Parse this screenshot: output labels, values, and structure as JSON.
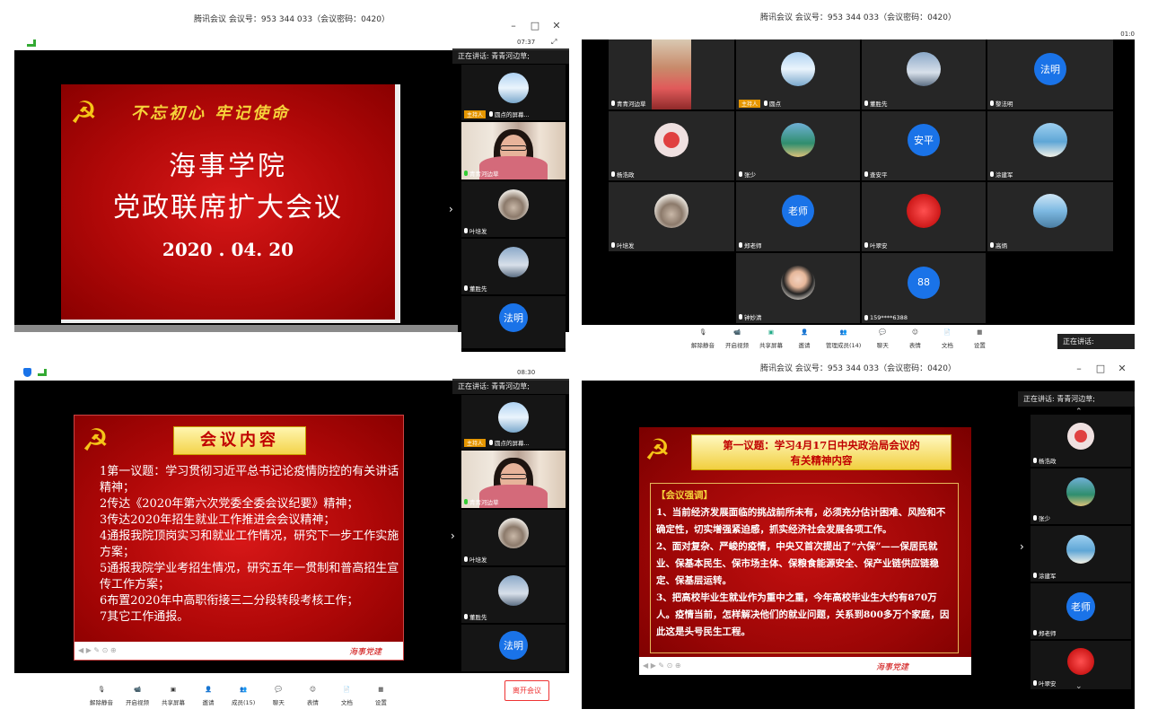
{
  "app_title": "腾讯会议 会议号：953 344 033（会议密码：0420）",
  "speaker_label": "正在讲话: 青青河边草;",
  "speaker_label_short": "正在讲话:",
  "timer_tl": "07:37",
  "timer_bl": "08:30",
  "timer_tr": "01:0",
  "host_badge": "主持人",
  "toolbar": {
    "mute": "解除静音",
    "video": "开启视频",
    "share": "共享屏幕",
    "invite": "邀请",
    "members15": "成员(15)",
    "members14": "管理成员(14)",
    "chat": "聊天",
    "emoji": "表情",
    "docs": "文档",
    "settings": "设置",
    "leave": "离开会议"
  },
  "slide1": {
    "motto": "不忘初心 牢记使命",
    "title1": "海事学院",
    "title2": "党政联席扩大会议",
    "date": "2020 . 04. 20"
  },
  "slide2": {
    "title": "会议内容",
    "items": [
      "1第一议题：学习贯彻习近平总书记论疫情防控的有关讲话精神；",
      "2传达《2020年第六次党委全委会议纪要》精神；",
      "3传达2020年招生就业工作推进会会议精神；",
      "4通报我院顶岗实习和就业工作情况，研究下一步工作实施方案；",
      "5通报我院学业考招生情况，研究五年一贯制和普高招生宣传工作方案；",
      "6布置2020年中高职衔接三二分段转段考核工作；",
      "7其它工作通报。"
    ],
    "footer": "海事党建"
  },
  "slide3": {
    "title1": "第一议题：学习4月17日中央政治局会议的",
    "title2": "有关精神内容",
    "section": "【会议强调】",
    "p1": "1、当前经济发展面临的挑战前所未有，必须充分估计困难、风险和不确定性，切实增强紧迫感，抓实经济社会发展各项工作。",
    "p2": "2、面对复杂、严峻的疫情，中央又首次提出了“六保”——保居民就业、保基本民生、保市场主体、保粮食能源安全、保产业链供应链稳定、保基层运转。",
    "p3": "3、把高校毕业生就业作为重中之重，今年高校毕业生大约有870万人。疫情当前，怎样解决他们的就业问题，关系到800多万个家庭，因此这是头号民生工程。",
    "footer": "海事党建"
  },
  "panel_tl": [
    {
      "name": "圆点的屏幕..."
    },
    {
      "name": "青青河边草"
    },
    {
      "name": "叶培发"
    },
    {
      "name": "董胜先"
    },
    {
      "name": "法明",
      "label": "法明"
    },
    {
      "name": "黎法明"
    }
  ],
  "panel_bl": [
    {
      "name": "圆点的屏幕..."
    },
    {
      "name": "青青河边草"
    },
    {
      "name": "叶培发"
    },
    {
      "name": "董胜先"
    },
    {
      "name": "法明",
      "label": "法明"
    },
    {
      "name": "黎法明"
    }
  ],
  "panel_br": [
    {
      "name": "杨浩政"
    },
    {
      "name": "张少"
    },
    {
      "name": "涂建军"
    },
    {
      "name": "郑老师",
      "label": "老师"
    },
    {
      "name": "叶翠安"
    }
  ],
  "grid": [
    {
      "name": "青青河边草",
      "label": ""
    },
    {
      "name": "圆点",
      "label": ""
    },
    {
      "name": "董胜先",
      "label": ""
    },
    {
      "name": "黎法明",
      "label": "法明"
    },
    {
      "name": "杨浩政",
      "label": ""
    },
    {
      "name": "张少",
      "label": ""
    },
    {
      "name": "查安平",
      "label": "安平"
    },
    {
      "name": "涂建军",
      "label": ""
    },
    {
      "name": "叶培发",
      "label": ""
    },
    {
      "name": "郑老师",
      "label": "老师"
    },
    {
      "name": "叶翠安",
      "label": ""
    },
    {
      "name": "高炳",
      "label": ""
    },
    {
      "name": "钟妙清",
      "label": ""
    },
    {
      "name": "159****6388",
      "label": "88"
    }
  ]
}
